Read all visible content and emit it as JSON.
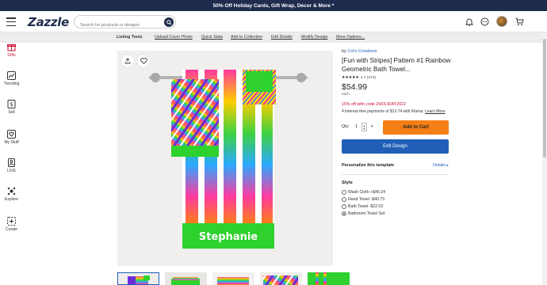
{
  "promo_bar": {
    "text": "50% Off Holiday Cards, Gift Wrap, Décor & More *"
  },
  "header": {
    "logo": "Zazzle",
    "search_placeholder": "Search for products or designs"
  },
  "toolbar": {
    "title": "Listing Tools",
    "items": [
      "Upload Cover Photo",
      "Quick Stats",
      "Add to Collection",
      "Edit Details",
      "Modify Design",
      "More Options..."
    ]
  },
  "sidebar": {
    "items": [
      {
        "label": "Gifts",
        "icon": "gift-icon"
      },
      {
        "label": "Trending",
        "icon": "trending-icon"
      },
      {
        "label": "Sell",
        "icon": "sell-icon"
      },
      {
        "label": "My Stuff",
        "icon": "heart-box-icon"
      },
      {
        "label": "LIVE",
        "icon": "live-icon"
      },
      {
        "label": "Explore",
        "icon": "explore-icon"
      },
      {
        "label": "Create",
        "icon": "create-icon"
      }
    ]
  },
  "product": {
    "by_prefix": "by",
    "creator": "Col's Creations",
    "title": "[Fun with Stripes] Pattern #1 Rainbow Geometric Bath Towel...",
    "stars": "★★★★★",
    "rating": "4.7 (374)",
    "price": "$54.99",
    "price_unit": "each",
    "promo": "15% off with code ZHOLIDAY2022",
    "klarna_text": "4 interest-free payments of $13.74 with Klarna.",
    "klarna_link": "Learn More",
    "qty_label": "Qty:",
    "qty_value": "1",
    "add_to_cart": "Add to Cart",
    "edit_design": "Edit Design",
    "personalize_title": "Personalize this template",
    "details_link": "Details ▸",
    "style_title": "Style",
    "style_options": [
      {
        "label": "Wash Cloth",
        "price": "+$46.24",
        "selected": false
      },
      {
        "label": "Hand Towel",
        "price": "-$40.73",
        "selected": false
      },
      {
        "label": "Bath Towel",
        "price": "-$22.02",
        "selected": false
      },
      {
        "label": "Bathroom Towel Set",
        "price": "",
        "selected": true
      }
    ],
    "towel_name": "Stephanie"
  },
  "colors": {
    "navy": "#1f2c4d",
    "orange": "#f57f17",
    "blue": "#1f5fb8",
    "red": "#c8102e",
    "green": "#2ed12e"
  }
}
